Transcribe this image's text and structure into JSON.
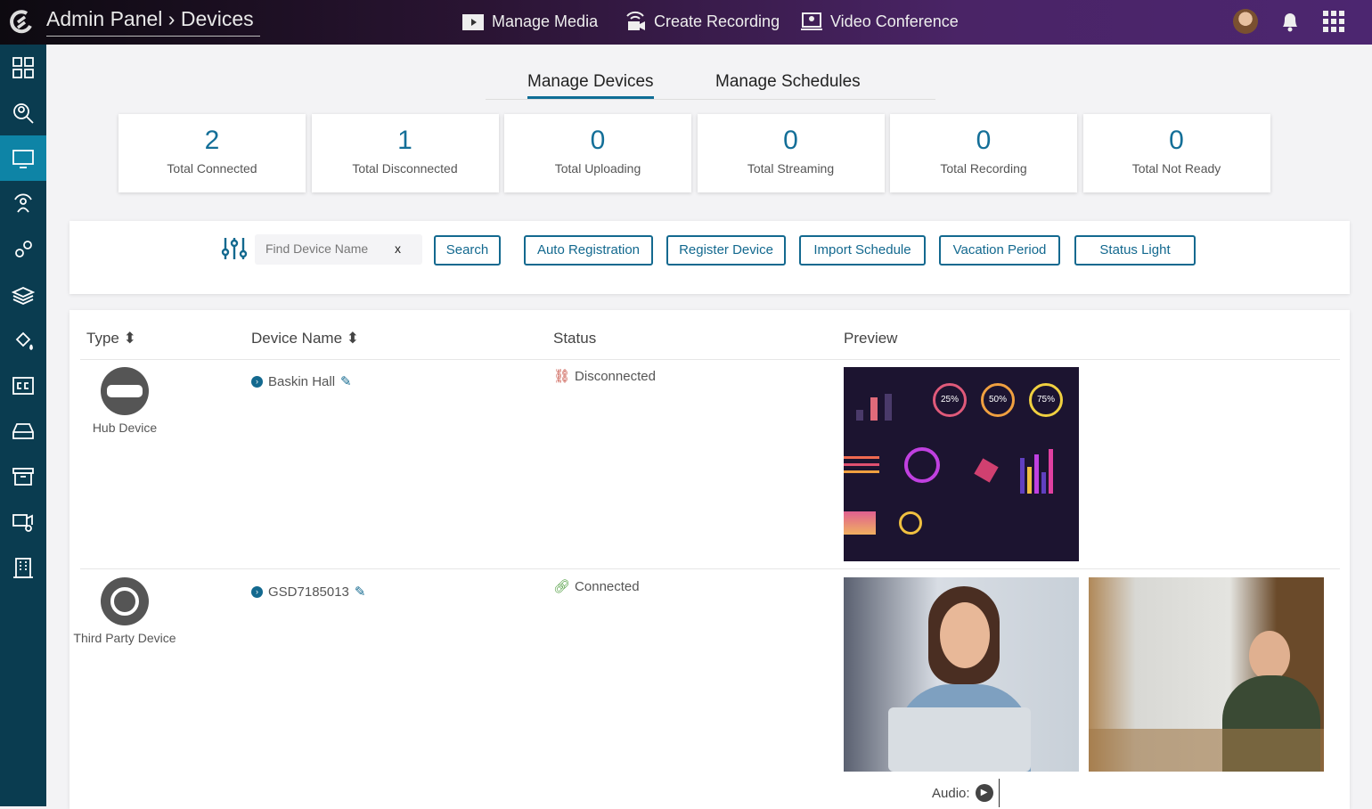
{
  "header": {
    "breadcrumb": "Admin Panel › Devices",
    "nav": [
      {
        "label": "Manage Media",
        "icon": "media-icon"
      },
      {
        "label": "Create Recording",
        "icon": "recording-icon"
      },
      {
        "label": "Video Conference",
        "icon": "conference-icon"
      }
    ]
  },
  "sidebar": {
    "items": [
      {
        "icon": "dashboard-icon"
      },
      {
        "icon": "search-user-icon"
      },
      {
        "icon": "devices-icon",
        "active": true
      },
      {
        "icon": "users-icon"
      },
      {
        "icon": "settings-icon"
      },
      {
        "icon": "layers-icon"
      },
      {
        "icon": "paint-icon"
      },
      {
        "icon": "captions-icon"
      },
      {
        "icon": "storage-icon"
      },
      {
        "icon": "archive-icon"
      },
      {
        "icon": "camera-settings-icon"
      },
      {
        "icon": "building-icon"
      }
    ]
  },
  "tabs": [
    "Manage Devices",
    "Manage Schedules"
  ],
  "stats": [
    {
      "n": "2",
      "l": "Total Connected"
    },
    {
      "n": "1",
      "l": "Total Disconnected"
    },
    {
      "n": "0",
      "l": "Total Uploading"
    },
    {
      "n": "0",
      "l": "Total Streaming"
    },
    {
      "n": "0",
      "l": "Total Recording"
    },
    {
      "n": "0",
      "l": "Total Not Ready"
    }
  ],
  "toolbar": {
    "placeholder": "Find Device Name",
    "clear": "x",
    "search": "Search",
    "buttons": [
      "Auto Registration",
      "Register Device",
      "Import Schedule",
      "Vacation Period",
      "Status Light"
    ]
  },
  "table": {
    "headers": [
      "Type",
      "Device Name",
      "Status",
      "Preview"
    ],
    "sort": "⬍",
    "rows": [
      {
        "type": "Hub Device",
        "name": "Baskin Hall",
        "status": "Disconnected",
        "status_color": "#c0392b",
        "preview_text": [
          "25%",
          "50%",
          "75%"
        ]
      },
      {
        "type": "Third Party Device",
        "name": "GSD7185013",
        "status": "Connected",
        "status_color": "#4a9a3a",
        "audio": "Audio:"
      }
    ]
  },
  "colors": {
    "accent": "#13698f",
    "sidebar": "#0a3c50",
    "sidebar_active": "#0e84a6"
  }
}
